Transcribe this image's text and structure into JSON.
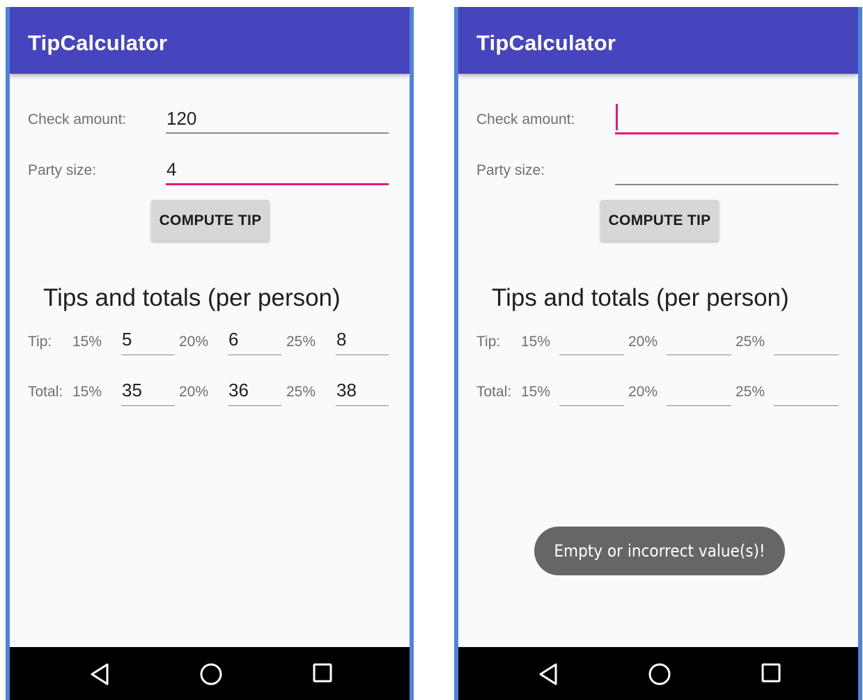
{
  "screens": [
    {
      "app_title": "TipCalculator",
      "check_amount_label": "Check amount:",
      "check_amount_value": "120",
      "party_size_label": "Party size:",
      "party_size_value": "4",
      "compute_button_label": "COMPUTE TIP",
      "results_title": "Tips and totals (per person)",
      "tip_label": "Tip:",
      "total_label": "Total:",
      "percentages": [
        "15%",
        "20%",
        "25%"
      ],
      "tips": [
        "5",
        "6",
        "8"
      ],
      "totals": [
        "35",
        "36",
        "38"
      ],
      "focused_field": "party_size"
    },
    {
      "app_title": "TipCalculator",
      "check_amount_label": "Check amount:",
      "check_amount_value": "",
      "party_size_label": "Party size:",
      "party_size_value": "",
      "compute_button_label": "COMPUTE TIP",
      "results_title": "Tips and totals (per person)",
      "tip_label": "Tip:",
      "total_label": "Total:",
      "percentages": [
        "15%",
        "20%",
        "25%"
      ],
      "tips": [
        "",
        "",
        ""
      ],
      "totals": [
        "",
        "",
        ""
      ],
      "focused_field": "check_amount",
      "toast": "Empty or incorrect value(s)!"
    }
  ],
  "navbar": {
    "icons": [
      "back-triangle-icon",
      "home-circle-icon",
      "recents-square-icon"
    ],
    "background": "#000000"
  },
  "colors": {
    "app_bar": "#4745bd",
    "accent": "#e6177c",
    "button": "#d6d7d7",
    "toast": "#666666",
    "frame": "#4f83dc"
  }
}
